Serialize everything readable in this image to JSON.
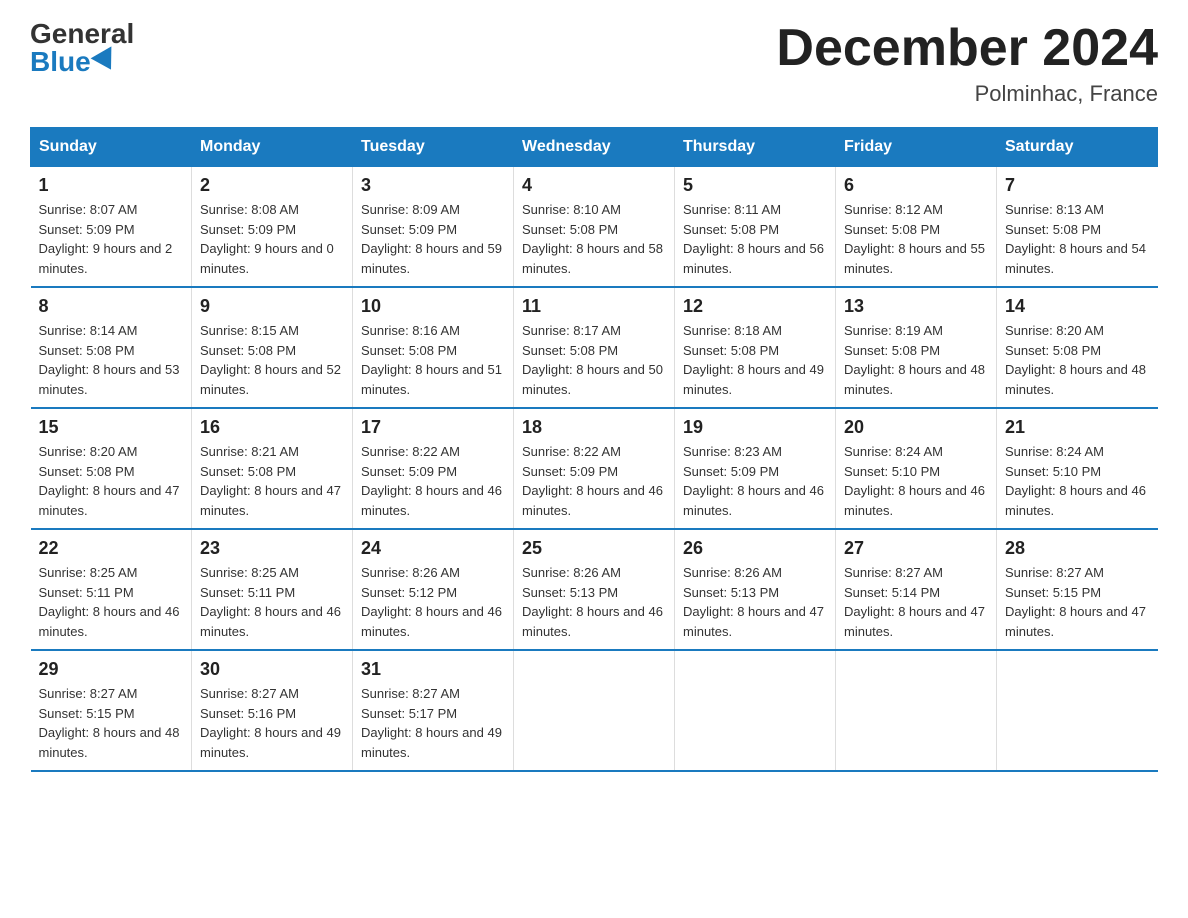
{
  "header": {
    "logo_general": "General",
    "logo_blue": "Blue",
    "title": "December 2024",
    "location": "Polminhac, France"
  },
  "days_of_week": [
    "Sunday",
    "Monday",
    "Tuesday",
    "Wednesday",
    "Thursday",
    "Friday",
    "Saturday"
  ],
  "weeks": [
    [
      {
        "day": "1",
        "sunrise": "8:07 AM",
        "sunset": "5:09 PM",
        "daylight": "9 hours and 2 minutes."
      },
      {
        "day": "2",
        "sunrise": "8:08 AM",
        "sunset": "5:09 PM",
        "daylight": "9 hours and 0 minutes."
      },
      {
        "day": "3",
        "sunrise": "8:09 AM",
        "sunset": "5:09 PM",
        "daylight": "8 hours and 59 minutes."
      },
      {
        "day": "4",
        "sunrise": "8:10 AM",
        "sunset": "5:08 PM",
        "daylight": "8 hours and 58 minutes."
      },
      {
        "day": "5",
        "sunrise": "8:11 AM",
        "sunset": "5:08 PM",
        "daylight": "8 hours and 56 minutes."
      },
      {
        "day": "6",
        "sunrise": "8:12 AM",
        "sunset": "5:08 PM",
        "daylight": "8 hours and 55 minutes."
      },
      {
        "day": "7",
        "sunrise": "8:13 AM",
        "sunset": "5:08 PM",
        "daylight": "8 hours and 54 minutes."
      }
    ],
    [
      {
        "day": "8",
        "sunrise": "8:14 AM",
        "sunset": "5:08 PM",
        "daylight": "8 hours and 53 minutes."
      },
      {
        "day": "9",
        "sunrise": "8:15 AM",
        "sunset": "5:08 PM",
        "daylight": "8 hours and 52 minutes."
      },
      {
        "day": "10",
        "sunrise": "8:16 AM",
        "sunset": "5:08 PM",
        "daylight": "8 hours and 51 minutes."
      },
      {
        "day": "11",
        "sunrise": "8:17 AM",
        "sunset": "5:08 PM",
        "daylight": "8 hours and 50 minutes."
      },
      {
        "day": "12",
        "sunrise": "8:18 AM",
        "sunset": "5:08 PM",
        "daylight": "8 hours and 49 minutes."
      },
      {
        "day": "13",
        "sunrise": "8:19 AM",
        "sunset": "5:08 PM",
        "daylight": "8 hours and 48 minutes."
      },
      {
        "day": "14",
        "sunrise": "8:20 AM",
        "sunset": "5:08 PM",
        "daylight": "8 hours and 48 minutes."
      }
    ],
    [
      {
        "day": "15",
        "sunrise": "8:20 AM",
        "sunset": "5:08 PM",
        "daylight": "8 hours and 47 minutes."
      },
      {
        "day": "16",
        "sunrise": "8:21 AM",
        "sunset": "5:08 PM",
        "daylight": "8 hours and 47 minutes."
      },
      {
        "day": "17",
        "sunrise": "8:22 AM",
        "sunset": "5:09 PM",
        "daylight": "8 hours and 46 minutes."
      },
      {
        "day": "18",
        "sunrise": "8:22 AM",
        "sunset": "5:09 PM",
        "daylight": "8 hours and 46 minutes."
      },
      {
        "day": "19",
        "sunrise": "8:23 AM",
        "sunset": "5:09 PM",
        "daylight": "8 hours and 46 minutes."
      },
      {
        "day": "20",
        "sunrise": "8:24 AM",
        "sunset": "5:10 PM",
        "daylight": "8 hours and 46 minutes."
      },
      {
        "day": "21",
        "sunrise": "8:24 AM",
        "sunset": "5:10 PM",
        "daylight": "8 hours and 46 minutes."
      }
    ],
    [
      {
        "day": "22",
        "sunrise": "8:25 AM",
        "sunset": "5:11 PM",
        "daylight": "8 hours and 46 minutes."
      },
      {
        "day": "23",
        "sunrise": "8:25 AM",
        "sunset": "5:11 PM",
        "daylight": "8 hours and 46 minutes."
      },
      {
        "day": "24",
        "sunrise": "8:26 AM",
        "sunset": "5:12 PM",
        "daylight": "8 hours and 46 minutes."
      },
      {
        "day": "25",
        "sunrise": "8:26 AM",
        "sunset": "5:13 PM",
        "daylight": "8 hours and 46 minutes."
      },
      {
        "day": "26",
        "sunrise": "8:26 AM",
        "sunset": "5:13 PM",
        "daylight": "8 hours and 47 minutes."
      },
      {
        "day": "27",
        "sunrise": "8:27 AM",
        "sunset": "5:14 PM",
        "daylight": "8 hours and 47 minutes."
      },
      {
        "day": "28",
        "sunrise": "8:27 AM",
        "sunset": "5:15 PM",
        "daylight": "8 hours and 47 minutes."
      }
    ],
    [
      {
        "day": "29",
        "sunrise": "8:27 AM",
        "sunset": "5:15 PM",
        "daylight": "8 hours and 48 minutes."
      },
      {
        "day": "30",
        "sunrise": "8:27 AM",
        "sunset": "5:16 PM",
        "daylight": "8 hours and 49 minutes."
      },
      {
        "day": "31",
        "sunrise": "8:27 AM",
        "sunset": "5:17 PM",
        "daylight": "8 hours and 49 minutes."
      },
      null,
      null,
      null,
      null
    ]
  ],
  "labels": {
    "sunrise": "Sunrise:",
    "sunset": "Sunset:",
    "daylight": "Daylight:"
  }
}
